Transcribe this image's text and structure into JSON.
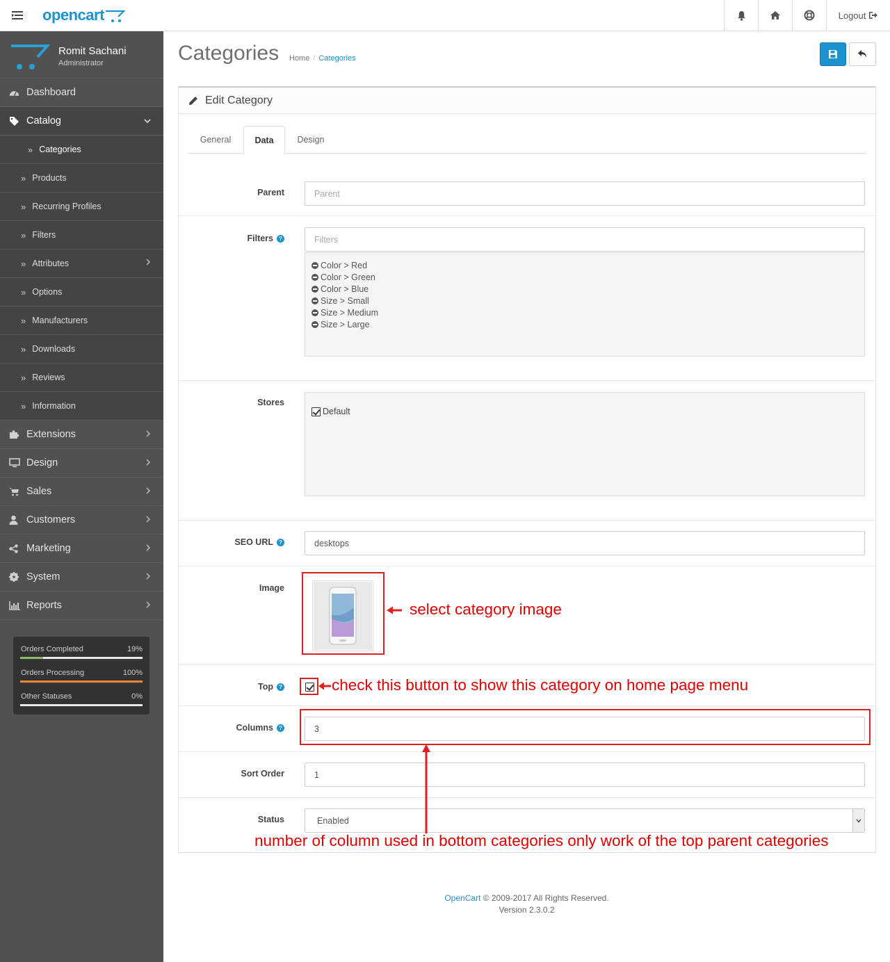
{
  "header": {
    "logo_text": "opencart",
    "logout_label": "Logout",
    "icons": [
      "menu-icon",
      "bell-icon",
      "home-icon",
      "life-ring-icon",
      "sign-out-icon"
    ]
  },
  "profile": {
    "name": "Romit Sachani",
    "role": "Administrator"
  },
  "sidebar": {
    "items": [
      {
        "label": "Dashboard",
        "icon": "dashboard-icon"
      },
      {
        "label": "Catalog",
        "icon": "tags-icon"
      },
      {
        "label": "Extensions",
        "icon": "puzzle-icon"
      },
      {
        "label": "Design",
        "icon": "desktop-icon"
      },
      {
        "label": "Sales",
        "icon": "cart-icon"
      },
      {
        "label": "Customers",
        "icon": "user-icon"
      },
      {
        "label": "Marketing",
        "icon": "share-icon"
      },
      {
        "label": "System",
        "icon": "cog-icon"
      },
      {
        "label": "Reports",
        "icon": "bar-chart-icon"
      }
    ],
    "catalog_sub": [
      "Categories",
      "Products",
      "Recurring Profiles",
      "Filters",
      "Attributes",
      "Options",
      "Manufacturers",
      "Downloads",
      "Reviews",
      "Information"
    ]
  },
  "stats": [
    {
      "label": "Orders Completed",
      "value": "19%",
      "fraction": 0.19,
      "color": "#8fbb6c"
    },
    {
      "label": "Orders Processing",
      "value": "100%",
      "fraction": 1.0,
      "color": "#f38733"
    },
    {
      "label": "Other Statuses",
      "value": "0%",
      "fraction": 0.0,
      "color": "#1e91cf"
    }
  ],
  "page": {
    "title": "Categories",
    "breadcrumb": [
      "Home",
      "Categories"
    ]
  },
  "panel": {
    "title": "Edit Category",
    "tabs": [
      "General",
      "Data",
      "Design"
    ],
    "active_tab": "Data"
  },
  "form": {
    "parent": {
      "label": "Parent",
      "placeholder": "Parent",
      "value": ""
    },
    "filters": {
      "label": "Filters",
      "placeholder": "Filters",
      "items": [
        "Color > Red",
        "Color > Green",
        "Color > Blue",
        "Size > Small",
        "Size > Medium",
        "Size > Large"
      ]
    },
    "stores": {
      "label": "Stores",
      "items": [
        {
          "name": "Default",
          "checked": true
        }
      ]
    },
    "seo_url": {
      "label": "SEO URL",
      "value": "desktops"
    },
    "image": {
      "label": "Image"
    },
    "top": {
      "label": "Top",
      "checked": true
    },
    "columns": {
      "label": "Columns",
      "value": "3"
    },
    "sort_order": {
      "label": "Sort Order",
      "value": "1"
    },
    "status": {
      "label": "Status",
      "value": "Enabled"
    }
  },
  "annotations": {
    "image": "select category image",
    "top": "check this button to show this category on home page menu",
    "columns": "number of column used in bottom categories only work of the top parent categories"
  },
  "footer": {
    "link": "OpenCart",
    "copyright": " © 2009-2017 All Rights Reserved.",
    "version": "Version 2.3.0.2"
  },
  "colors": {
    "accent": "#1e91cf",
    "sidebar": "#515151",
    "annotation": "#e00000"
  }
}
